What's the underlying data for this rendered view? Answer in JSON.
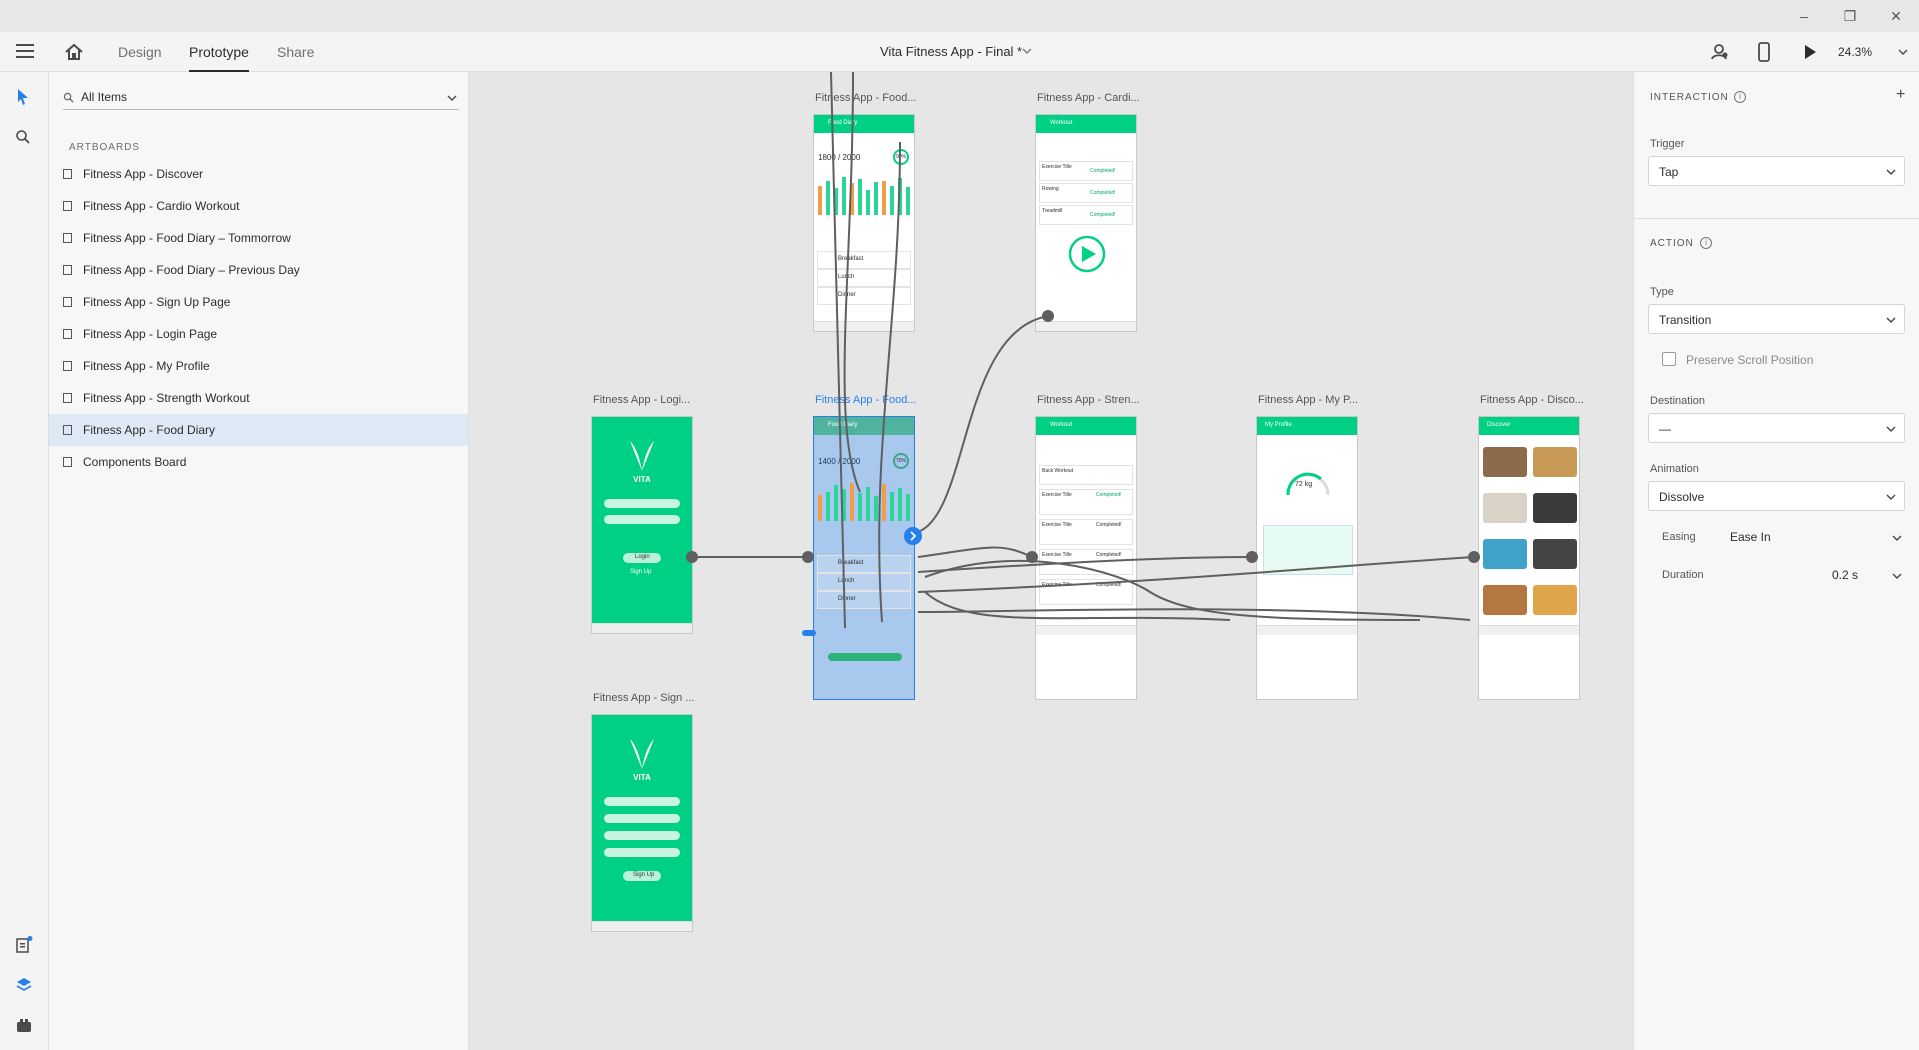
{
  "window": {
    "title": "Vita Fitness App - Final *",
    "controls": [
      "minimize",
      "maximize",
      "close"
    ]
  },
  "toolbar": {
    "tabs": [
      {
        "label": "Design",
        "active": false
      },
      {
        "label": "Prototype",
        "active": true
      },
      {
        "label": "Share",
        "active": false
      }
    ],
    "zoom": "24.3%",
    "icons": [
      "hamburger-menu-icon",
      "home-icon",
      "user-settings-icon",
      "mobile-preview-icon",
      "play-icon",
      "chevron-down-icon"
    ]
  },
  "left_rail": {
    "icons": [
      "select-arrow-icon",
      "search-icon",
      "document-assets-icon",
      "layers-icon",
      "plugins-icon"
    ]
  },
  "layers_panel": {
    "search_value": "All Items",
    "section_label": "ARTBOARDS",
    "artboards": [
      {
        "label": "Fitness App - Discover",
        "selected": false
      },
      {
        "label": "Fitness App - Cardio Workout",
        "selected": false
      },
      {
        "label": "Fitness App - Food Diary – Tommorrow",
        "selected": false
      },
      {
        "label": "Fitness App - Food Diary – Previous Day",
        "selected": false
      },
      {
        "label": "Fitness App - Sign Up Page",
        "selected": false
      },
      {
        "label": "Fitness App - Login Page",
        "selected": false
      },
      {
        "label": "Fitness App - My Profile",
        "selected": false
      },
      {
        "label": "Fitness App - Strength Workout",
        "selected": false
      },
      {
        "label": "Fitness App - Food Diary",
        "selected": true
      },
      {
        "label": "Components Board",
        "selected": false
      }
    ]
  },
  "properties": {
    "interaction_title": "INTERACTION",
    "trigger_label": "Trigger",
    "trigger_value": "Tap",
    "action_title": "ACTION",
    "type_label": "Type",
    "type_value": "Transition",
    "preserve_scroll_label": "Preserve Scroll Position",
    "preserve_scroll_checked": false,
    "destination_label": "Destination",
    "destination_value": "—",
    "animation_label": "Animation",
    "animation_value": "Dissolve",
    "easing_label": "Easing",
    "easing_value": "Ease In",
    "duration_label": "Duration",
    "duration_value": "0.2 s"
  },
  "canvas": {
    "artboard_titles": {
      "food_top": "Fitness App - Food...",
      "cardio": "Fitness App - Cardi...",
      "login": "Fitness App - Logi...",
      "food_selected": "Fitness App - Food...",
      "strength": "Fitness App - Stren...",
      "profile": "Fitness App - My P...",
      "discover": "Fitness App - Disco...",
      "signup": "Fitness App - Sign ..."
    },
    "food_diary": {
      "header": "Food Diary",
      "calories": "1400 / 2000",
      "calories_top": "1800 / 2000",
      "percent": "70%",
      "percent_top": "90%",
      "meals": [
        "Breakfast",
        "Lunch",
        "Dinner"
      ],
      "bar_levels": [
        0.62,
        0.7,
        0.85,
        0.75,
        0.9,
        0.66,
        0.8,
        0.6,
        0.88,
        0.7,
        0.78,
        0.65
      ],
      "bar_levels_top": [
        0.7,
        0.8,
        0.65,
        0.9,
        0.75,
        0.85,
        0.6,
        0.78,
        0.82,
        0.7,
        0.88,
        0.66
      ]
    },
    "vita_brand": "VITA",
    "login_labels": {
      "login": "Login",
      "signup": "Sign Up"
    },
    "signup_labels": {
      "signup": "Sign Up"
    },
    "workout_header": "Workout",
    "profile_header": "My Profile",
    "profile_weight": "72 kg",
    "discover_header": "Discover",
    "cardio_items": [
      "Exercise Title",
      "Rowing",
      "Treadmill"
    ],
    "completed": "Completed!",
    "strength_items": [
      "Back Workout",
      "Exercise Title",
      "Exercise Title",
      "Exercise Title",
      "Exercise Title"
    ],
    "colors": {
      "brand_green": "#00d084",
      "selection_blue": "#2680eb",
      "wire_gray": "#5f5f5f"
    }
  }
}
